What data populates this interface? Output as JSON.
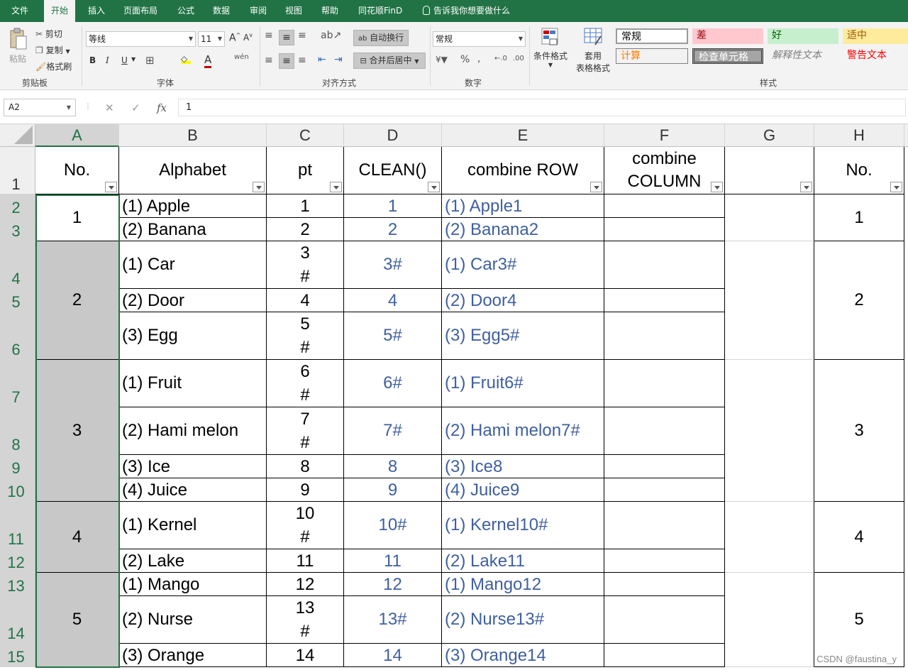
{
  "tabs": [
    "文件",
    "开始",
    "插入",
    "页面布局",
    "公式",
    "数据",
    "审阅",
    "视图",
    "帮助",
    "同花顺FinD"
  ],
  "tell_me": "告诉我你想要做什么",
  "ribbon": {
    "clipboard": {
      "paste": "粘贴",
      "cut": "剪切",
      "copy": "复制",
      "format_painter": "格式刷",
      "label": "剪贴板"
    },
    "font": {
      "name": "等线",
      "size": "11",
      "bold": "B",
      "italic": "I",
      "underline": "U",
      "label": "字体"
    },
    "alignment": {
      "wrap": "自动换行",
      "merge": "合并后居中",
      "label": "对齐方式"
    },
    "number": {
      "format": "常规",
      "label": "数字"
    },
    "styles": {
      "conditional": "条件格式",
      "table_line1": "套用",
      "table_line2": "表格格式",
      "label": "样式",
      "cells": [
        {
          "text": "常规",
          "bg": "#ffffff",
          "fg": "#000000"
        },
        {
          "text": "差",
          "bg": "#ffc7ce",
          "fg": "#9c0006"
        },
        {
          "text": "好",
          "bg": "#c6efce",
          "fg": "#006100"
        },
        {
          "text": "适中",
          "bg": "#ffeb9c",
          "fg": "#9c5700"
        },
        {
          "text": "计算",
          "bg": "#f2f2f2",
          "fg": "#fa7d00"
        },
        {
          "text": "检查单元格",
          "bg": "#a5a5a5",
          "fg": "#ffffff"
        },
        {
          "text": "解释性文本",
          "bg": "#f3f3f3",
          "fg": "#7f7f7f"
        },
        {
          "text": "警告文本",
          "bg": "#f3f3f3",
          "fg": "#ff0000"
        }
      ]
    }
  },
  "formula_bar": {
    "name_box": "A2",
    "formula": "1"
  },
  "columns": [
    "A",
    "B",
    "C",
    "D",
    "E",
    "F",
    "G",
    "H"
  ],
  "rows": [
    "1",
    "2",
    "3",
    "4",
    "5",
    "6",
    "7",
    "8",
    "9",
    "10",
    "11",
    "12",
    "13",
    "14",
    "15"
  ],
  "headers": {
    "a": "No.",
    "b": "Alphabet",
    "c": "pt",
    "d": "CLEAN()",
    "e": "combine ROW",
    "f_line1": "combine",
    "f_line2": "COLUMN",
    "h": "No."
  },
  "data_rows": [
    {
      "b": "(1) Apple",
      "c": "1",
      "c2": "",
      "d": "1",
      "e": "(1) Apple1"
    },
    {
      "b": "(2) Banana",
      "c": "2",
      "c2": "",
      "d": "2",
      "e": "(2) Banana2"
    },
    {
      "b": "(1) Car",
      "c": "3",
      "c2": "#",
      "d": "3#",
      "e": "(1) Car3#"
    },
    {
      "b": "(2) Door",
      "c": "4",
      "c2": "",
      "d": "4",
      "e": "(2) Door4"
    },
    {
      "b": "(3) Egg",
      "c": "5",
      "c2": "#",
      "d": "5#",
      "e": "(3) Egg5#"
    },
    {
      "b": "(1) Fruit",
      "c": "6",
      "c2": "#",
      "d": "6#",
      "e": "(1) Fruit6#"
    },
    {
      "b": "(2) Hami melon",
      "c": "7",
      "c2": "#",
      "d": "7#",
      "e": "(2) Hami melon7#"
    },
    {
      "b": "(3) Ice",
      "c": "8",
      "c2": "",
      "d": "8",
      "e": "(3) Ice8"
    },
    {
      "b": "(4) Juice",
      "c": "9",
      "c2": "",
      "d": "9",
      "e": "(4) Juice9"
    },
    {
      "b": "(1) Kernel",
      "c": "10",
      "c2": "#",
      "d": "10#",
      "e": "(1) Kernel10#"
    },
    {
      "b": "(2) Lake",
      "c": "11",
      "c2": "",
      "d": "11",
      "e": "(2) Lake11"
    },
    {
      "b": "(1) Mango",
      "c": "12",
      "c2": "",
      "d": "12",
      "e": "(1) Mango12"
    },
    {
      "b": "(2) Nurse",
      "c": "13",
      "c2": "#",
      "d": "13#",
      "e": "(2) Nurse13#"
    },
    {
      "b": "(3) Orange",
      "c": "14",
      "c2": "",
      "d": "14",
      "e": "(3) Orange14"
    }
  ],
  "groups": [
    "1",
    "2",
    "3",
    "4",
    "5"
  ],
  "watermark": "CSDN @faustina_y"
}
